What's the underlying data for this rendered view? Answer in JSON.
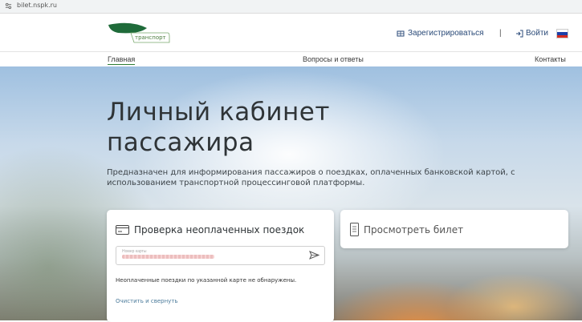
{
  "browser": {
    "url": "bilet.nspk.ru"
  },
  "header": {
    "logo_text": "транспорт",
    "register_label": "Зарегистрироваться",
    "separator": "|",
    "login_label": "Войти"
  },
  "nav": {
    "home": "Главная",
    "faq": "Вопросы и ответы",
    "contacts": "Контакты"
  },
  "hero": {
    "title": "Личный кабинет пассажира",
    "description": "Предназначен для информирования пассажиров о поездках, оплаченных банковской картой, с использованием транспортной процессинговой платформы."
  },
  "check_card": {
    "title": "Проверка неоплаченных поездок",
    "input_placeholder": "Номер карты",
    "message": "Неоплаченные поездки по указанной карте не обнаружены.",
    "clear_link": "Очистить и свернуть"
  },
  "ticket_card": {
    "title": "Просмотреть билет"
  },
  "colors": {
    "accent_green": "#2e7d32",
    "link_blue": "#2a4a78"
  }
}
